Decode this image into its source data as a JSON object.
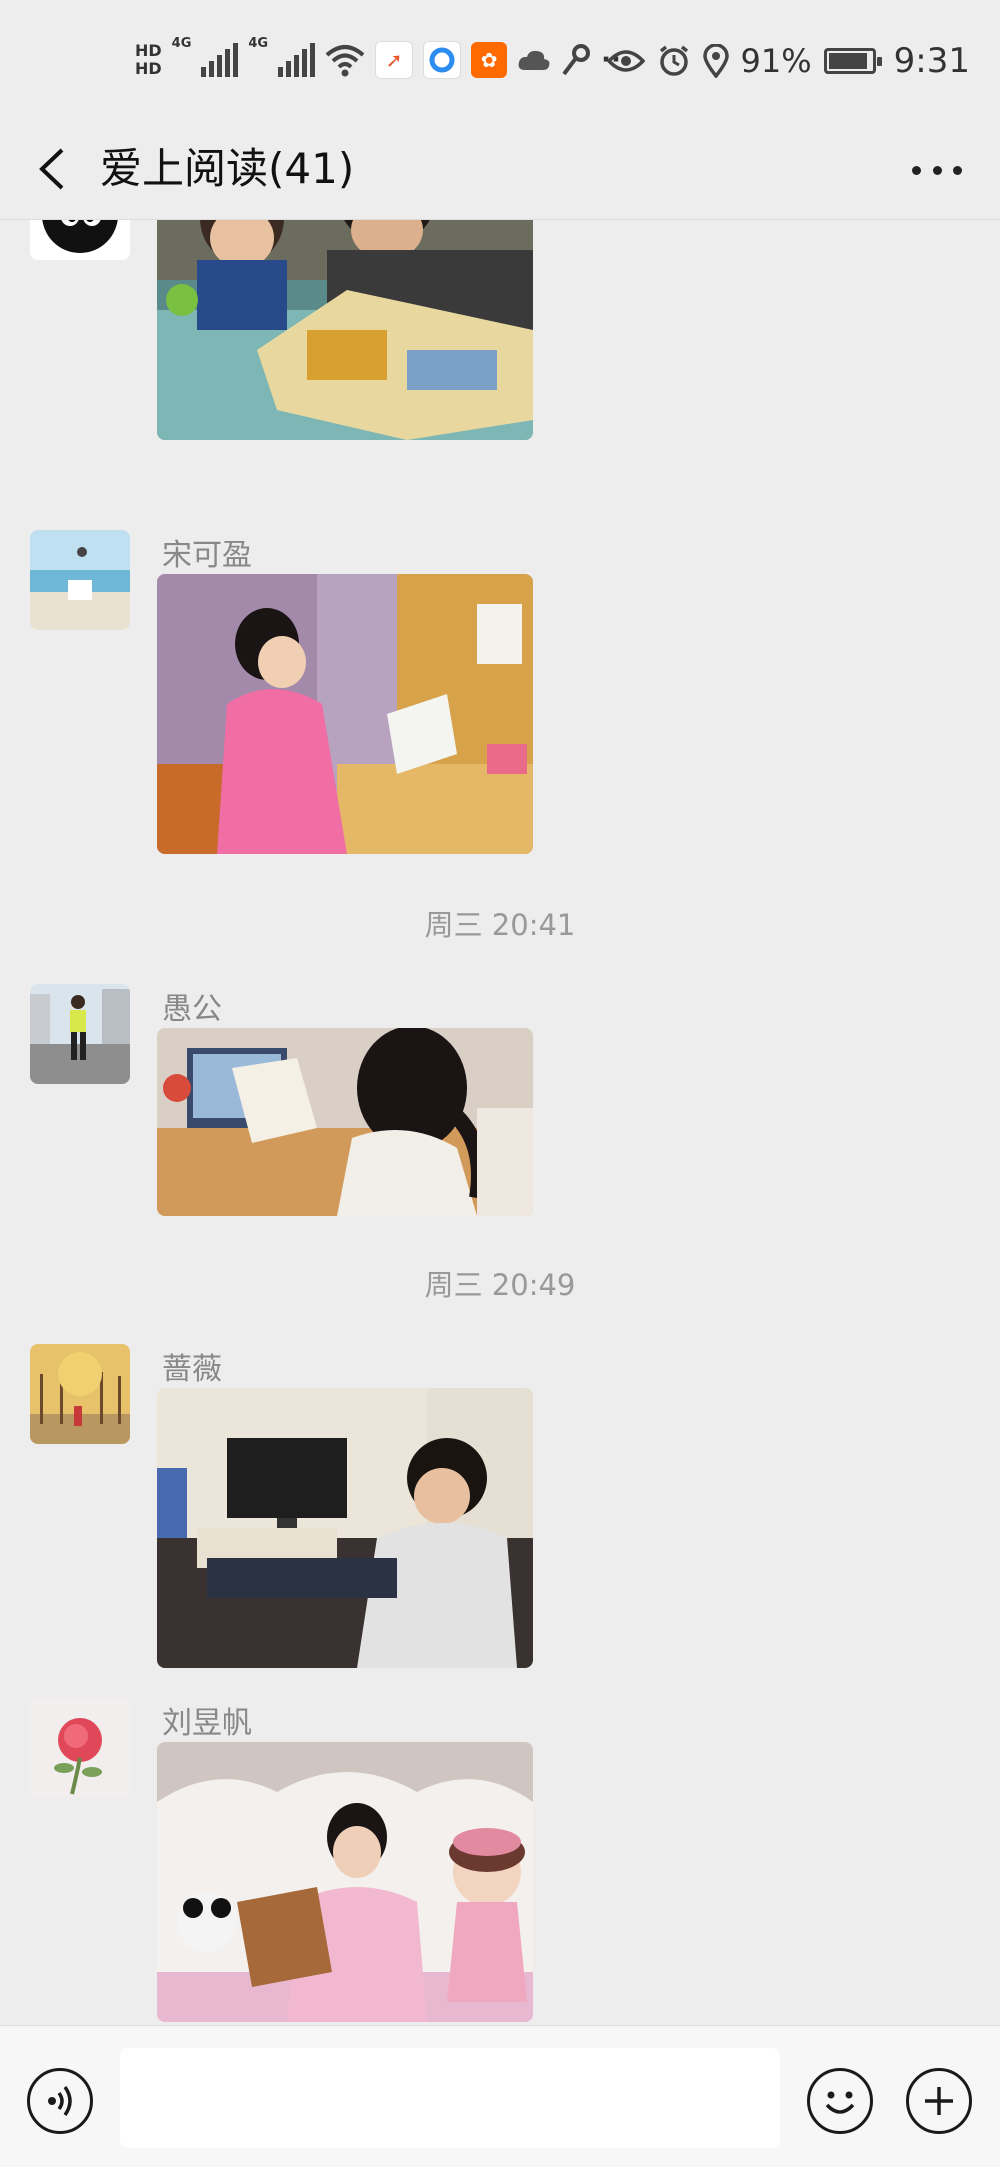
{
  "status_bar": {
    "hd1": "HD",
    "hd2": "HD",
    "net1": "4G",
    "net2": "4G",
    "dots": "···",
    "battery_percent": "91%",
    "battery_level": 0.91,
    "time": "9:31",
    "icons": [
      "wifi-icon",
      "app-icon-orange",
      "app-icon-blue",
      "app-icon-kuaishou",
      "cloud-icon",
      "key-icon",
      "eye-icon",
      "alarm-icon",
      "location-icon",
      "battery-icon"
    ]
  },
  "header": {
    "title": "爱上阅读(41)",
    "back_icon": "chevron-left-icon",
    "more_icon": "more-dots-icon"
  },
  "messages": [
    {
      "sender": "",
      "image": "photo-two-boys-reading"
    },
    {
      "sender": "宋可盈",
      "image": "photo-girl-reading-at-desk"
    },
    {
      "timestamp": "周三 20:41"
    },
    {
      "sender": "愚公",
      "image": "photo-girl-reading-with-laptop"
    },
    {
      "timestamp": "周三 20:49"
    },
    {
      "sender": "蔷薇",
      "image": "photo-boy-reading-at-desk"
    },
    {
      "sender": "刘昱帆",
      "image": "photo-girl-reading-on-bed"
    }
  ],
  "input_bar": {
    "value": "",
    "voice_icon": "voice-icon",
    "emoji_icon": "emoji-icon",
    "plus_icon": "plus-icon"
  }
}
